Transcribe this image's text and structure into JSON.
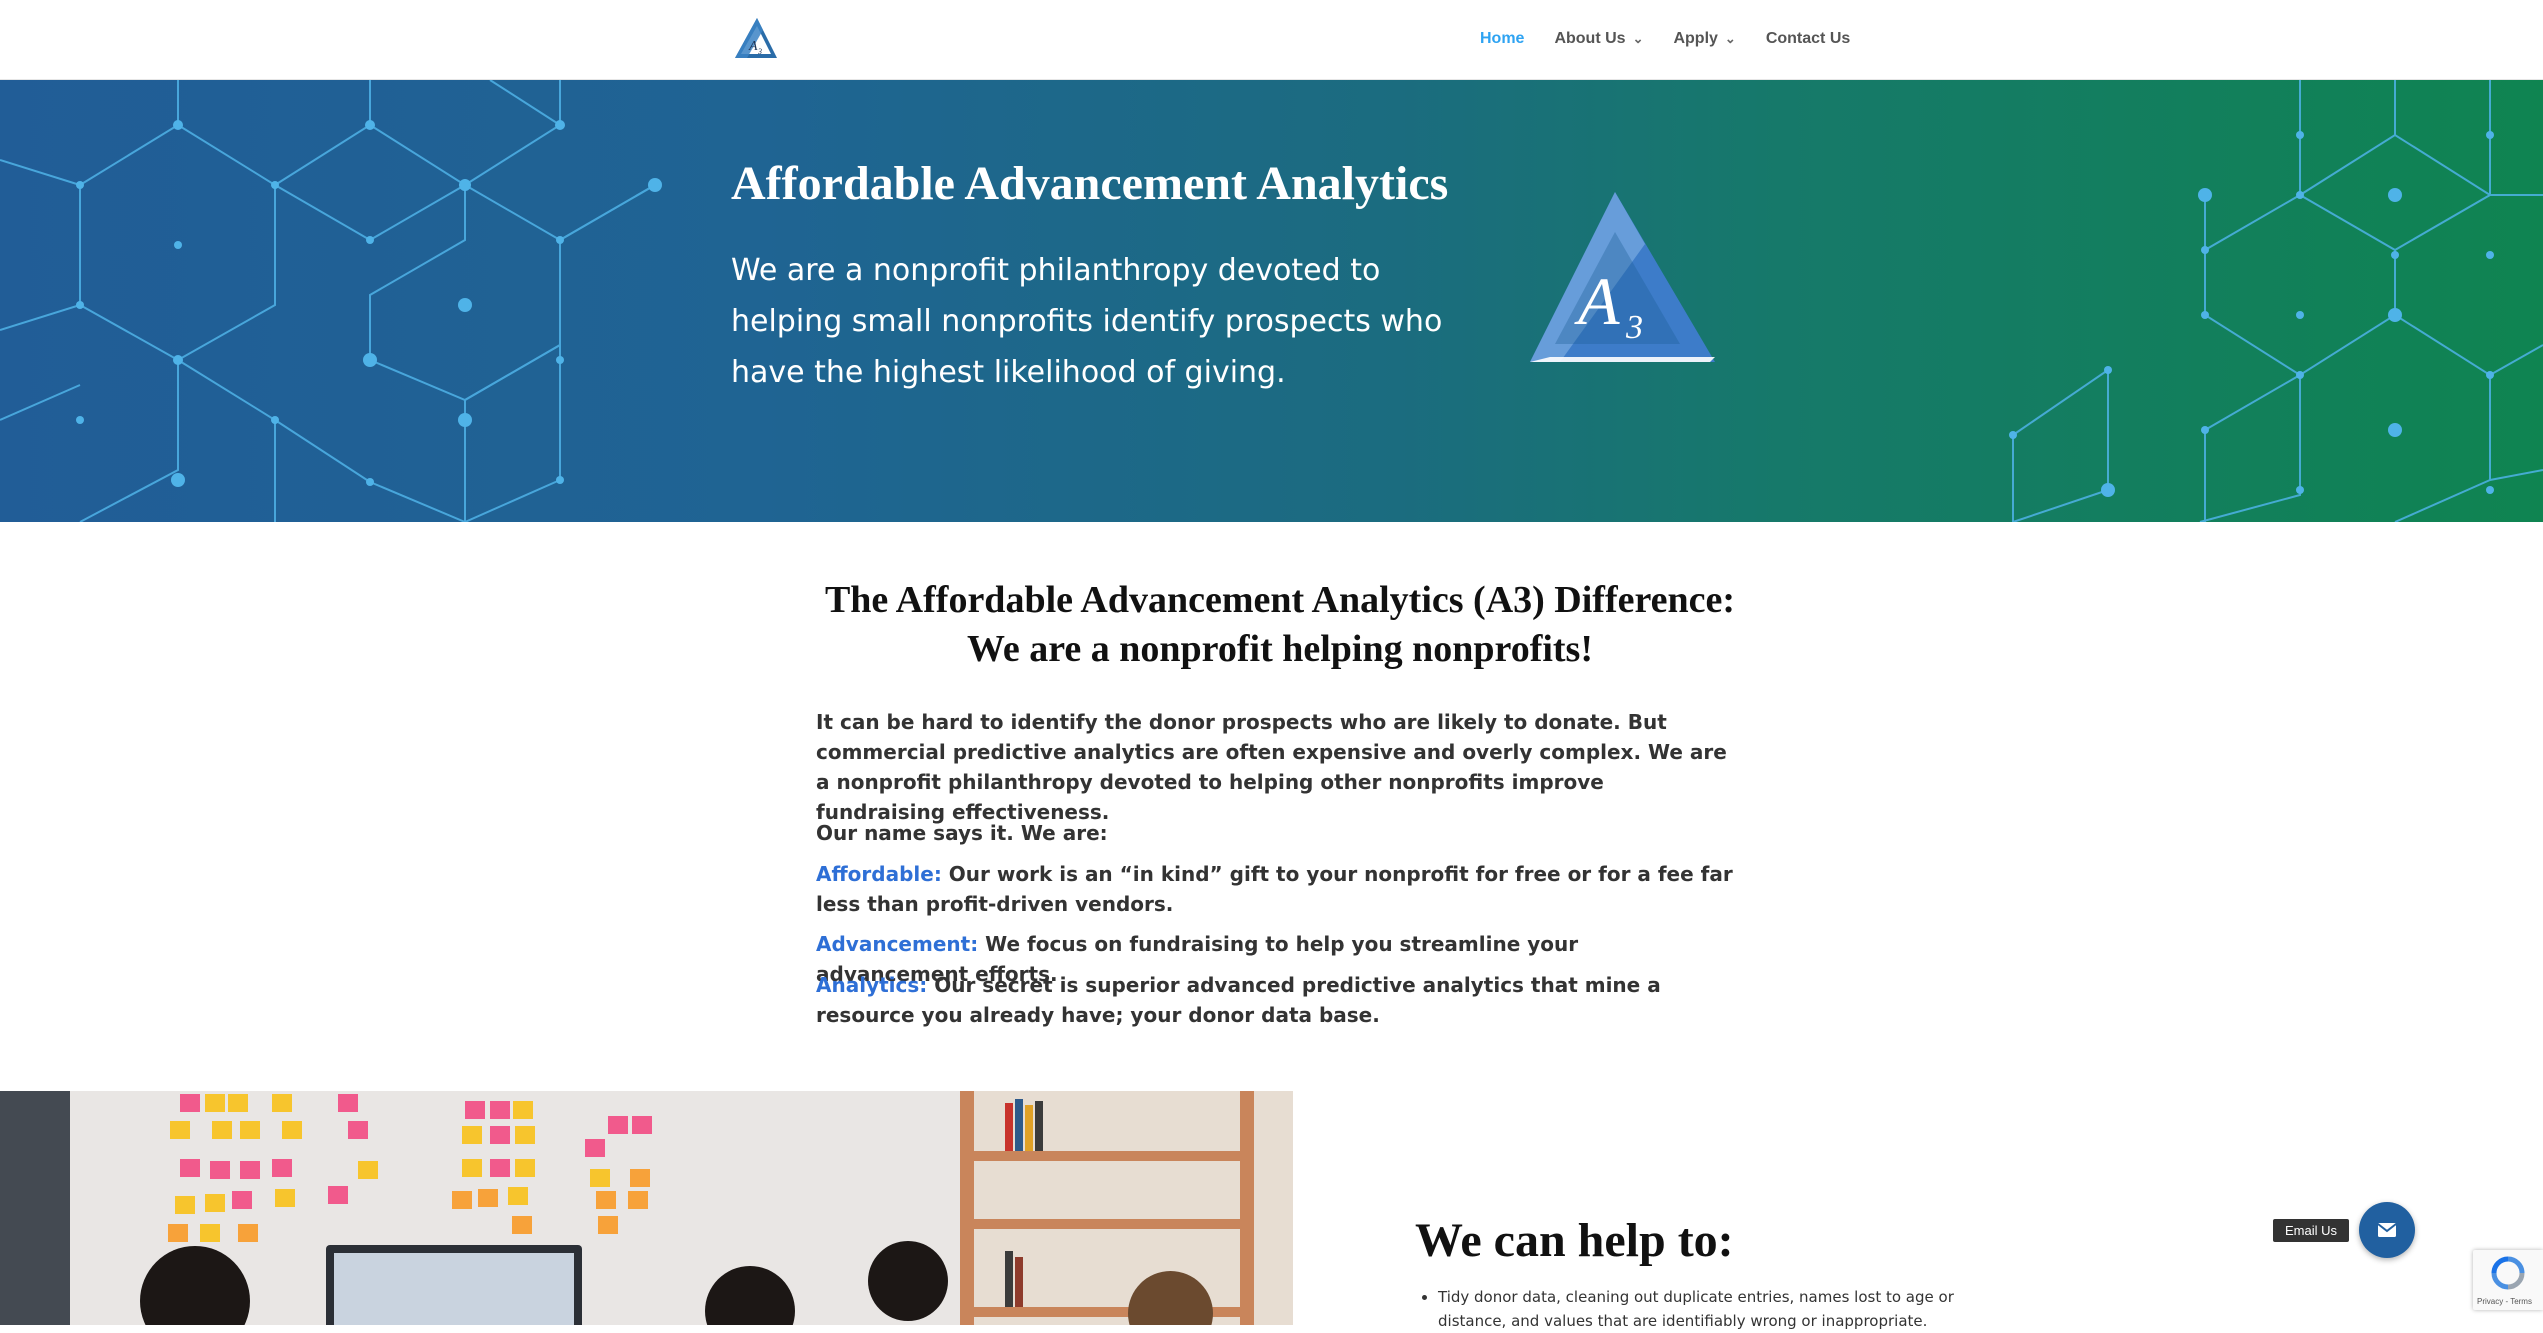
{
  "header": {
    "logo_alt": "A3",
    "nav": [
      {
        "label": "Home",
        "active": true,
        "has_dropdown": false
      },
      {
        "label": "About Us",
        "active": false,
        "has_dropdown": true
      },
      {
        "label": "Apply",
        "active": false,
        "has_dropdown": true
      },
      {
        "label": "Contact Us",
        "active": false,
        "has_dropdown": false
      }
    ]
  },
  "hero": {
    "title": "Affordable Advancement Analytics",
    "subtitle": "We are a nonprofit philanthropy devoted to helping small nonprofits identify prospects who have the highest likelihood of giving.",
    "logo_letter": "A",
    "logo_subscript": "3",
    "gradient_start": "#215d97",
    "gradient_end": "#0f8451"
  },
  "difference": {
    "title_line1": "The Affordable Advancement Analytics (A3) Difference:",
    "title_line2": "We are a nonprofit helping nonprofits!",
    "intro": "It can be hard to identify the donor prospects who are likely to donate. But commercial predictive analytics are often expensive and overly complex. We are a nonprofit philanthropy devoted to helping other nonprofits improve fundraising effectiveness.",
    "name_says": "Our name says it. We are:",
    "points": [
      {
        "term": "Affordable:",
        "text": " Our work is an “in kind” gift to your nonprofit for free or for a fee far less than profit-driven vendors."
      },
      {
        "term": "Advancement:",
        "text": " We focus on fundraising to help you streamline your advancement efforts."
      },
      {
        "term": "Analytics:",
        "text": " Our secret is superior advanced predictive analytics that mine a resource you already have; your donor data base."
      }
    ],
    "highlight_color": "#2e6fd6"
  },
  "help": {
    "title": "We can help to:",
    "items": [
      "Tidy donor data, cleaning out duplicate entries, names lost to age or distance, and values that are identifiably wrong or inappropriate."
    ]
  },
  "widgets": {
    "email_label": "Email Us",
    "recaptcha_links": "Privacy - Terms"
  }
}
